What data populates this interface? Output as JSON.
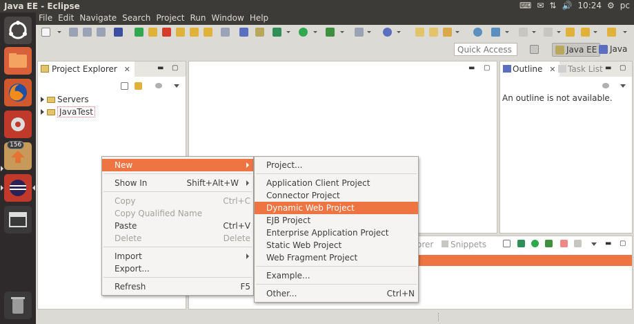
{
  "window": {
    "title": "Java EE - Eclipse"
  },
  "tray": {
    "clock": "10:24",
    "user": "pc"
  },
  "launcher": {
    "badge_count": "156"
  },
  "menubar": [
    "File",
    "Edit",
    "Navigate",
    "Search",
    "Project",
    "Run",
    "Window",
    "Help"
  ],
  "quick_access": {
    "placeholder": "Quick Access"
  },
  "perspectives": [
    {
      "label": "Java EE",
      "active": true
    },
    {
      "label": "Java",
      "active": false
    }
  ],
  "project_explorer": {
    "tab_label": "Project Explorer",
    "tree": [
      {
        "label": "Servers"
      },
      {
        "label": "JavaTest"
      }
    ]
  },
  "outline": {
    "tab_label": "Outline",
    "second_tab_label": "Task List",
    "message": "An outline is not available."
  },
  "bottom_panel": {
    "partial_tab_label": "orer",
    "snippets_tab_label": "Snippets"
  },
  "context_menu": {
    "items": [
      {
        "label": "New",
        "accelerator": "",
        "submenu": true,
        "highlighted": true,
        "disabled": false
      },
      {
        "label": "Show In",
        "accelerator": "Shift+Alt+W",
        "submenu": true,
        "disabled": false
      },
      {
        "label": "Copy",
        "accelerator": "Ctrl+C",
        "disabled": true
      },
      {
        "label": "Copy Qualified Name",
        "accelerator": "",
        "disabled": true
      },
      {
        "label": "Paste",
        "accelerator": "Ctrl+V",
        "disabled": false
      },
      {
        "label": "Delete",
        "accelerator": "Delete",
        "disabled": true
      },
      {
        "label": "Import",
        "accelerator": "",
        "submenu": true,
        "disabled": false
      },
      {
        "label": "Export...",
        "accelerator": "",
        "disabled": false
      },
      {
        "label": "Refresh",
        "accelerator": "F5",
        "disabled": false
      }
    ]
  },
  "new_submenu": {
    "items": [
      {
        "label": "Project...",
        "accelerator": ""
      },
      {
        "label": "Application Client Project",
        "accelerator": ""
      },
      {
        "label": "Connector Project",
        "accelerator": ""
      },
      {
        "label": "Dynamic Web Project",
        "accelerator": "",
        "highlighted": true
      },
      {
        "label": "EJB Project",
        "accelerator": ""
      },
      {
        "label": "Enterprise Application Project",
        "accelerator": ""
      },
      {
        "label": "Static Web Project",
        "accelerator": ""
      },
      {
        "label": "Web Fragment Project",
        "accelerator": ""
      },
      {
        "label": "Example...",
        "accelerator": ""
      },
      {
        "label": "Other...",
        "accelerator": "Ctrl+N"
      }
    ]
  },
  "colors": {
    "highlight": "#ee7442",
    "menubar_bg": "#3c3b37",
    "launcher_bg": "#2e2a2b"
  }
}
